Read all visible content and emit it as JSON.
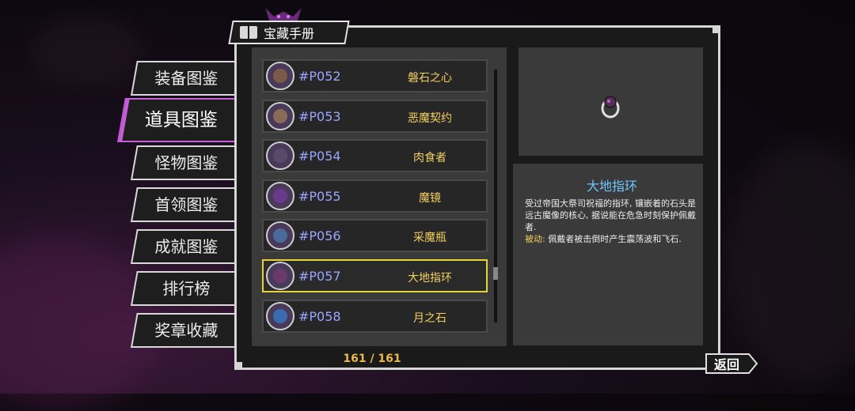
{
  "panel": {
    "title": "宝藏手册",
    "count": "161 / 161",
    "back_label": "返回"
  },
  "tabs": [
    {
      "label": "装备图鉴",
      "active": false
    },
    {
      "label": "道具图鉴",
      "active": true
    },
    {
      "label": "怪物图鉴",
      "active": false
    },
    {
      "label": "首领图鉴",
      "active": false
    },
    {
      "label": "成就图鉴",
      "active": false
    },
    {
      "label": "排行榜",
      "active": false
    },
    {
      "label": "奖章收藏",
      "active": false
    }
  ],
  "items": [
    {
      "code": "#P052",
      "name": "磐石之心",
      "icon": "rock-heart-icon",
      "color": "#7a5a48"
    },
    {
      "code": "#P053",
      "name": "恶魔契约",
      "icon": "demon-contract-icon",
      "color": "#8a6a58"
    },
    {
      "code": "#P054",
      "name": "肉食者",
      "icon": "carnivore-icon",
      "color": "#5a4a6a"
    },
    {
      "code": "#P055",
      "name": "魔镜",
      "icon": "magic-mirror-icon",
      "color": "#6a3a8a"
    },
    {
      "code": "#P056",
      "name": "采魔瓶",
      "icon": "magic-bottle-icon",
      "color": "#4a6a9a"
    },
    {
      "code": "#P057",
      "name": "大地指环",
      "icon": "earth-ring-icon",
      "color": "#6a3a6a",
      "selected": true
    },
    {
      "code": "#P058",
      "name": "月之石",
      "icon": "moon-stone-icon",
      "color": "#3a6ab0"
    }
  ],
  "detail": {
    "title": "大地指环",
    "description": "受过帝国大祭司祝福的指环, 镶嵌着的石头是远古魔像的核心, 据说能在危急时刻保护佩戴者.",
    "passive_label": "被动:",
    "passive_text": " 佩戴者被击倒时产生震荡波和飞石."
  }
}
